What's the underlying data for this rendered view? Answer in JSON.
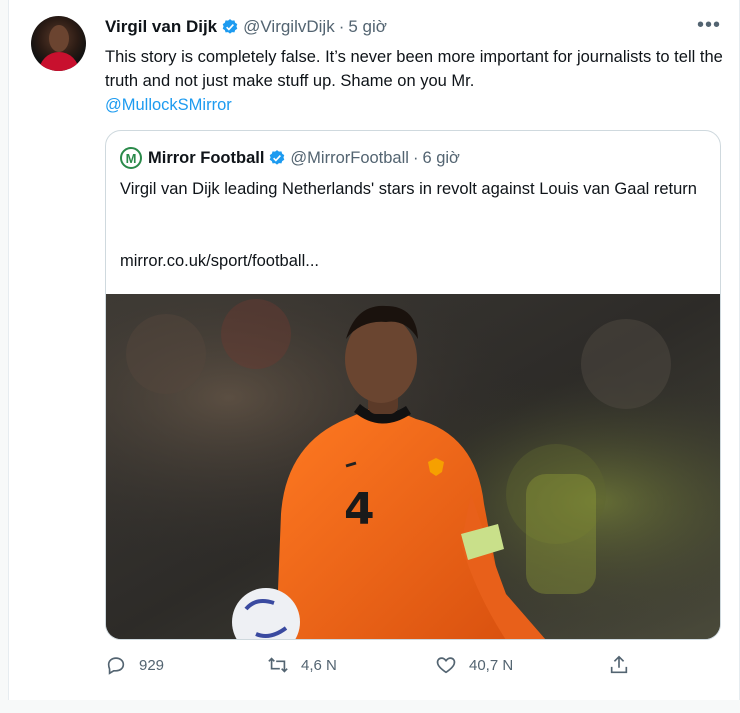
{
  "tweet": {
    "author_name": "Virgil van Dijk",
    "author_handle": "@VirgilvDijk",
    "separator": "·",
    "time": "5 giờ",
    "more": "•••",
    "text_main": "This story is completely false. It’s never been more important for journalists to tell the truth and not just make stuff up. Shame on you Mr.",
    "mention": "@MullockSMirror"
  },
  "quoted": {
    "logo_letter": "M",
    "author_name": "Mirror Football",
    "author_handle": "@MirrorFootball",
    "separator": "·",
    "time": "6 giờ",
    "text": "Virgil van Dijk leading Netherlands' stars in revolt against Louis van Gaal return",
    "link": "mirror.co.uk/sport/football...",
    "photo": {
      "shirt_number": "4"
    }
  },
  "actions": {
    "reply_count": "929",
    "retweet_count": "4,6 N",
    "like_count": "40,7 N"
  },
  "colors": {
    "accent": "#1d9bf0",
    "secondary_text": "#536471",
    "shirt_orange": "#f26a1b"
  }
}
